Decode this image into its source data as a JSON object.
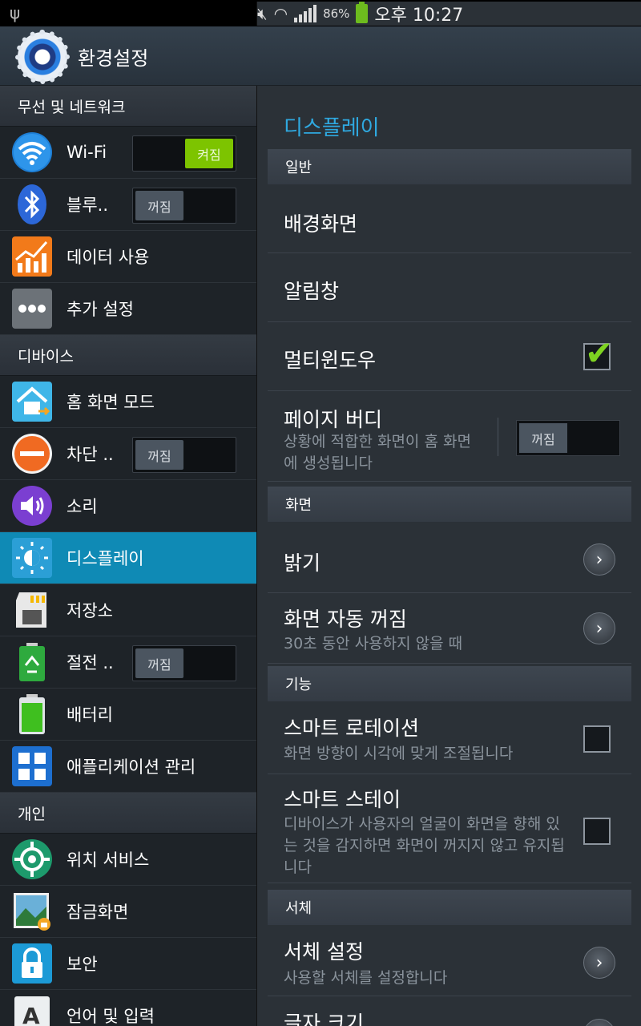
{
  "status": {
    "usb_icon": "usb-icon",
    "battery_pct": "86%",
    "time": "오후 10:27"
  },
  "header": {
    "title": "환경설정",
    "icon": "settings-gear-icon"
  },
  "sidebar": {
    "cat_wireless": "무선 및 네트워크",
    "wifi": "Wi-Fi",
    "wifi_toggle": "켜짐",
    "bluetooth": "블루..",
    "bluetooth_toggle": "꺼짐",
    "data_usage": "데이터 사용",
    "more_settings": "추가 설정",
    "cat_device": "디바이스",
    "home_mode": "홈 화면 모드",
    "block": "차단 ..",
    "block_toggle": "꺼짐",
    "sound": "소리",
    "display": "디스플레이",
    "storage": "저장소",
    "power_saving": "절전 ..",
    "power_toggle": "꺼짐",
    "battery": "배터리",
    "app_manager": "애플리케이션 관리",
    "cat_personal": "개인",
    "location": "위치 서비스",
    "lock_screen": "잠금화면",
    "security": "보안",
    "language": "언어 및 입력"
  },
  "main": {
    "title": "디스플레이",
    "sec_general": "일반",
    "wallpaper": "배경화면",
    "notification_panel": "알림창",
    "multi_window": "멀티윈도우",
    "multi_window_checked": true,
    "page_buddy": "페이지 버디",
    "page_buddy_desc": "상황에 적합한 화면이 홈 화면에 생성됩니다",
    "page_buddy_toggle": "꺼짐",
    "sec_screen": "화면",
    "brightness": "밝기",
    "screen_timeout": "화면 자동 꺼짐",
    "screen_timeout_desc": "30초 동안 사용하지 않을 때",
    "sec_features": "기능",
    "smart_rotation": "스마트 로테이션",
    "smart_rotation_desc": "화면 방향이 시각에 맞게 조절됩니다",
    "smart_stay": "스마트 스테이",
    "smart_stay_desc": "디바이스가 사용자의 얼굴이 화면을 향해 있는 것을 감지하면 화면이 꺼지지 않고 유지됩니다",
    "sec_font": "서체",
    "font_settings": "서체 설정",
    "font_settings_desc": "사용할 서체를 설정합니다",
    "font_size": "글자 크기"
  }
}
